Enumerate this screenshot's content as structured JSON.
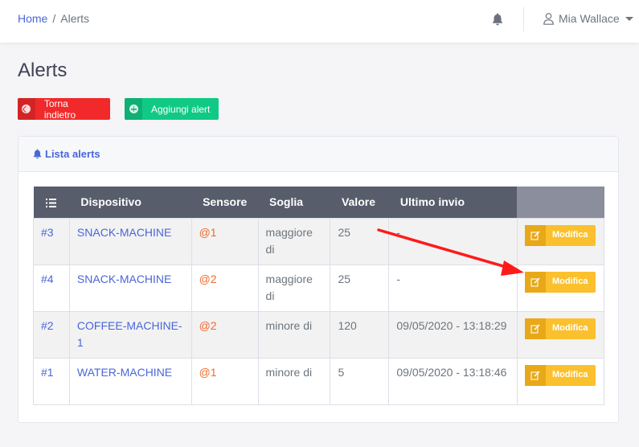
{
  "breadcrumb": {
    "home": "Home",
    "separator": "/",
    "current": "Alerts"
  },
  "header": {
    "user_name": "Mia Wallace"
  },
  "page": {
    "title": "Alerts"
  },
  "buttons": {
    "back": "Torna indietro",
    "add": "Aggiungi alert"
  },
  "card": {
    "title": "Lista alerts"
  },
  "table": {
    "columns": [
      "Dispositivo",
      "Sensore",
      "Soglia",
      "Valore",
      "Ultimo invio"
    ],
    "edit_label": "Modifica",
    "rows": [
      {
        "id": "3",
        "device": "SNACK-MACHINE",
        "sensor": "@1",
        "threshold": "maggiore di",
        "value": "25",
        "last_sent": "-"
      },
      {
        "id": "4",
        "device": "SNACK-MACHINE",
        "sensor": "@2",
        "threshold": "maggiore di",
        "value": "25",
        "last_sent": "-"
      },
      {
        "id": "2",
        "device": "COFFEE-MACHINE-1",
        "sensor": "@2",
        "threshold": "minore di",
        "value": "120",
        "last_sent": "09/05/2020 - 13:18:29"
      },
      {
        "id": "1",
        "device": "WATER-MACHINE",
        "sensor": "@1",
        "threshold": "minore di",
        "value": "5",
        "last_sent": "09/05/2020 - 13:18:46"
      }
    ]
  },
  "icons": {
    "top_bell": "bell-icon",
    "user": "user-icon",
    "back": "arrow-left-circle-icon",
    "add": "plus-circle-icon",
    "card": "bell-icon",
    "list": "list-icon",
    "edit": "edit-icon"
  },
  "annotation": {
    "color": "#ff1a1a"
  }
}
